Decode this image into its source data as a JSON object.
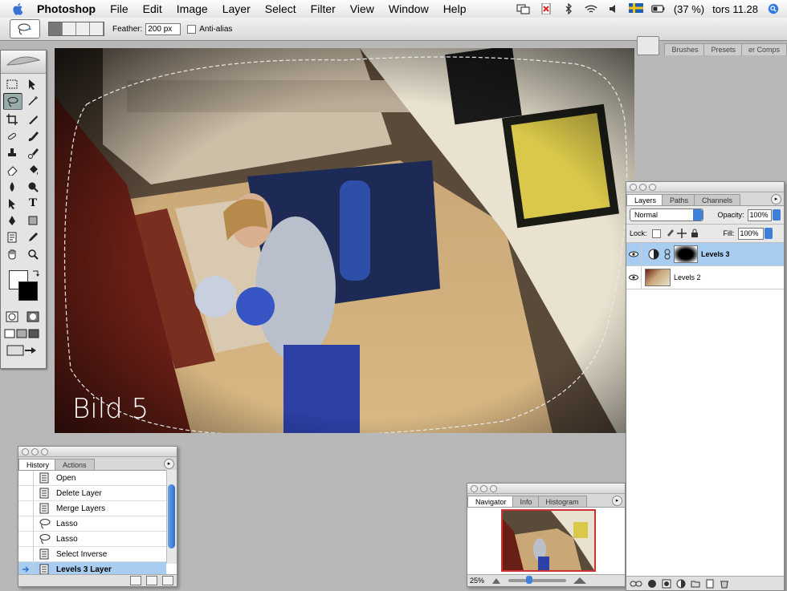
{
  "menubar": {
    "app_name": "Photoshop",
    "items": [
      "File",
      "Edit",
      "Image",
      "Layer",
      "Select",
      "Filter",
      "View",
      "Window",
      "Help"
    ],
    "battery": "(37 %)",
    "clock": "tors 11.28"
  },
  "options": {
    "feather_label": "Feather:",
    "feather_value": "200 px",
    "antialias_label": "Anti-alias",
    "well_tabs": [
      "Brushes",
      "Presets",
      "er Comps"
    ]
  },
  "canvas": {
    "caption": "Bild 5"
  },
  "history": {
    "tabs": [
      "History",
      "Actions"
    ],
    "items": [
      {
        "label": "Open",
        "icon": "doc-icon"
      },
      {
        "label": "Delete Layer",
        "icon": "doc-icon"
      },
      {
        "label": "Merge Layers",
        "icon": "doc-icon"
      },
      {
        "label": "Lasso",
        "icon": "lasso-icon"
      },
      {
        "label": "Lasso",
        "icon": "lasso-icon"
      },
      {
        "label": "Select Inverse",
        "icon": "doc-icon"
      },
      {
        "label": "Levels 3 Layer",
        "icon": "doc-icon"
      }
    ]
  },
  "navigator": {
    "tabs": [
      "Navigator",
      "Info",
      "Histogram"
    ],
    "zoom": "25%"
  },
  "layers": {
    "tabs": [
      "Layers",
      "Paths",
      "Channels"
    ],
    "blend_mode": "Normal",
    "opacity_label": "Opacity:",
    "opacity_value": "100%",
    "lock_label": "Lock:",
    "fill_label": "Fill:",
    "fill_value": "100%",
    "list": [
      {
        "name": "Levels 3"
      },
      {
        "name": "Levels 2"
      }
    ]
  }
}
